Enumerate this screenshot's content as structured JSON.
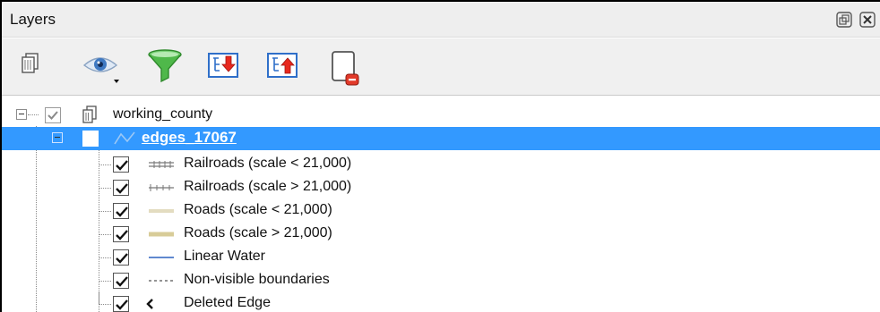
{
  "window": {
    "title": "Layers",
    "float_icon": "restore-icon",
    "close_icon": "close-icon"
  },
  "toolbar": {
    "buttons": [
      {
        "name": "add-group-button",
        "icon": "layer-group-icon"
      },
      {
        "name": "manage-visibility-button",
        "icon": "eye-icon"
      },
      {
        "name": "filter-legend-button",
        "icon": "funnel-icon"
      },
      {
        "name": "expand-all-button",
        "icon": "expand-all-icon"
      },
      {
        "name": "collapse-all-button",
        "icon": "collapse-all-icon"
      },
      {
        "name": "remove-layer-button",
        "icon": "remove-layer-icon"
      }
    ]
  },
  "tree": {
    "group": {
      "label": "working_county",
      "checked": true
    },
    "layer": {
      "label": "edges_17067",
      "checked": false,
      "selected": true
    },
    "legend": [
      {
        "label": "Railroads (scale < 21,000)",
        "checked": true,
        "symbol": "railroad-double-icon"
      },
      {
        "label": "Railroads (scale > 21,000)",
        "checked": true,
        "symbol": "railroad-ticks-icon"
      },
      {
        "label": "Roads (scale < 21,000)",
        "checked": true,
        "symbol": "road-light-icon"
      },
      {
        "label": "Roads (scale > 21,000)",
        "checked": true,
        "symbol": "road-tan-icon"
      },
      {
        "label": "Linear Water",
        "checked": true,
        "symbol": "water-line-icon"
      },
      {
        "label": "Non-visible boundaries",
        "checked": true,
        "symbol": "dashed-line-icon"
      },
      {
        "label": "Deleted Edge",
        "checked": true,
        "symbol": "chevron-left-icon"
      }
    ]
  },
  "colors": {
    "selection": "#3399ff",
    "water": "#4a78c8",
    "road_light": "#e3dcc0",
    "road_tan": "#d8cc98"
  }
}
